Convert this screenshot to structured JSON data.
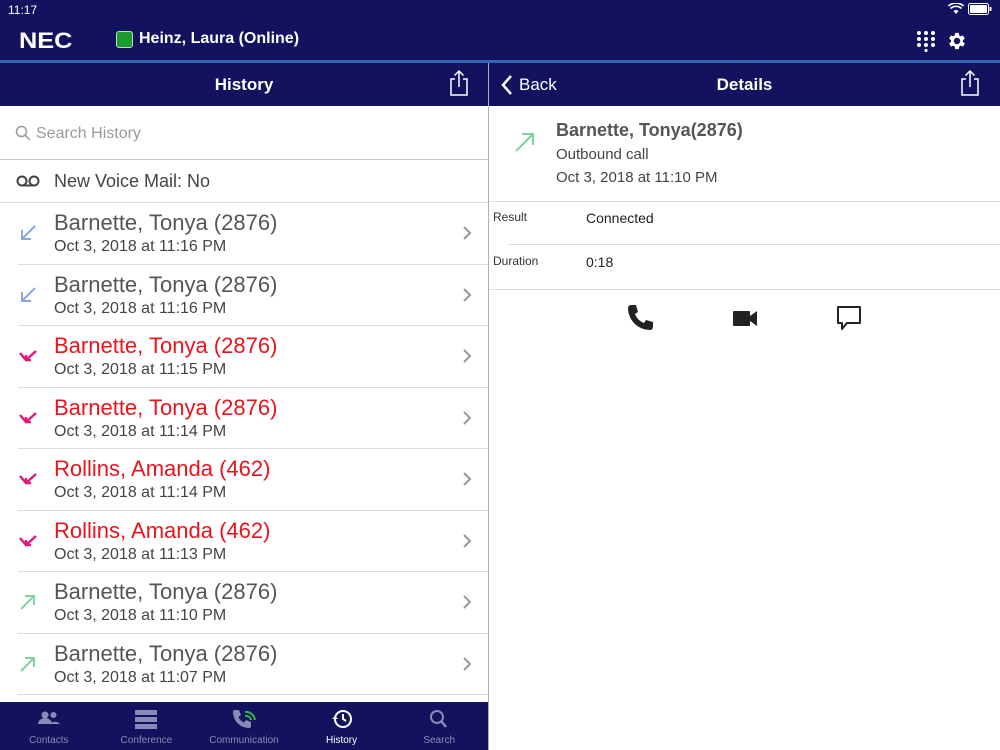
{
  "status": {
    "time": "11:17"
  },
  "app": {
    "brand": "NEC",
    "user_status": "Heinz, Laura (Online)",
    "presence_color": "#1f9a2e"
  },
  "history_panel": {
    "title": "History",
    "search_placeholder": "Search History",
    "voicemail_text": "New Voice Mail: No",
    "items": [
      {
        "name": "Barnette, Tonya (2876)",
        "date": "Oct 3, 2018 at 11:16 PM",
        "type": "incoming",
        "icon": "incoming-call-icon"
      },
      {
        "name": "Barnette, Tonya (2876)",
        "date": "Oct 3, 2018 at 11:16 PM",
        "type": "incoming",
        "icon": "incoming-call-icon"
      },
      {
        "name": "Barnette, Tonya (2876)",
        "date": "Oct 3, 2018 at 11:15 PM",
        "type": "missed",
        "icon": "missed-call-icon"
      },
      {
        "name": "Barnette, Tonya (2876)",
        "date": "Oct 3, 2018 at 11:14 PM",
        "type": "missed",
        "icon": "missed-call-icon"
      },
      {
        "name": "Rollins, Amanda (462)",
        "date": "Oct 3, 2018 at 11:14 PM",
        "type": "missed",
        "icon": "missed-call-icon"
      },
      {
        "name": "Rollins, Amanda (462)",
        "date": "Oct 3, 2018 at 11:13 PM",
        "type": "missed",
        "icon": "missed-call-icon"
      },
      {
        "name": "Barnette, Tonya (2876)",
        "date": "Oct 3, 2018 at 11:10 PM",
        "type": "outgoing",
        "icon": "outgoing-call-icon"
      },
      {
        "name": "Barnette, Tonya (2876)",
        "date": "Oct 3, 2018 at 11:07 PM",
        "type": "outgoing",
        "icon": "outgoing-call-icon"
      }
    ]
  },
  "tabs": [
    {
      "label": "Contacts",
      "icon": "contacts-icon"
    },
    {
      "label": "Conference",
      "icon": "conference-icon"
    },
    {
      "label": "Communication",
      "icon": "communication-icon"
    },
    {
      "label": "History",
      "icon": "history-icon",
      "active": true
    },
    {
      "label": "Search",
      "icon": "search-icon"
    }
  ],
  "details_panel": {
    "back_label": "Back",
    "title": "Details",
    "contact_name": "Barnette, Tonya(2876)",
    "call_type": "Outbound call",
    "date": "Oct 3, 2018 at 11:10 PM",
    "result_label": "Result",
    "result_value": "Connected",
    "duration_label": "Duration",
    "duration_value": "0:18"
  },
  "colors": {
    "nav_bg": "#12125e",
    "accent": "#3464b4",
    "missed": "#e8141e",
    "incoming": "#8aa8e0",
    "outgoing": "#7fd3a0"
  }
}
